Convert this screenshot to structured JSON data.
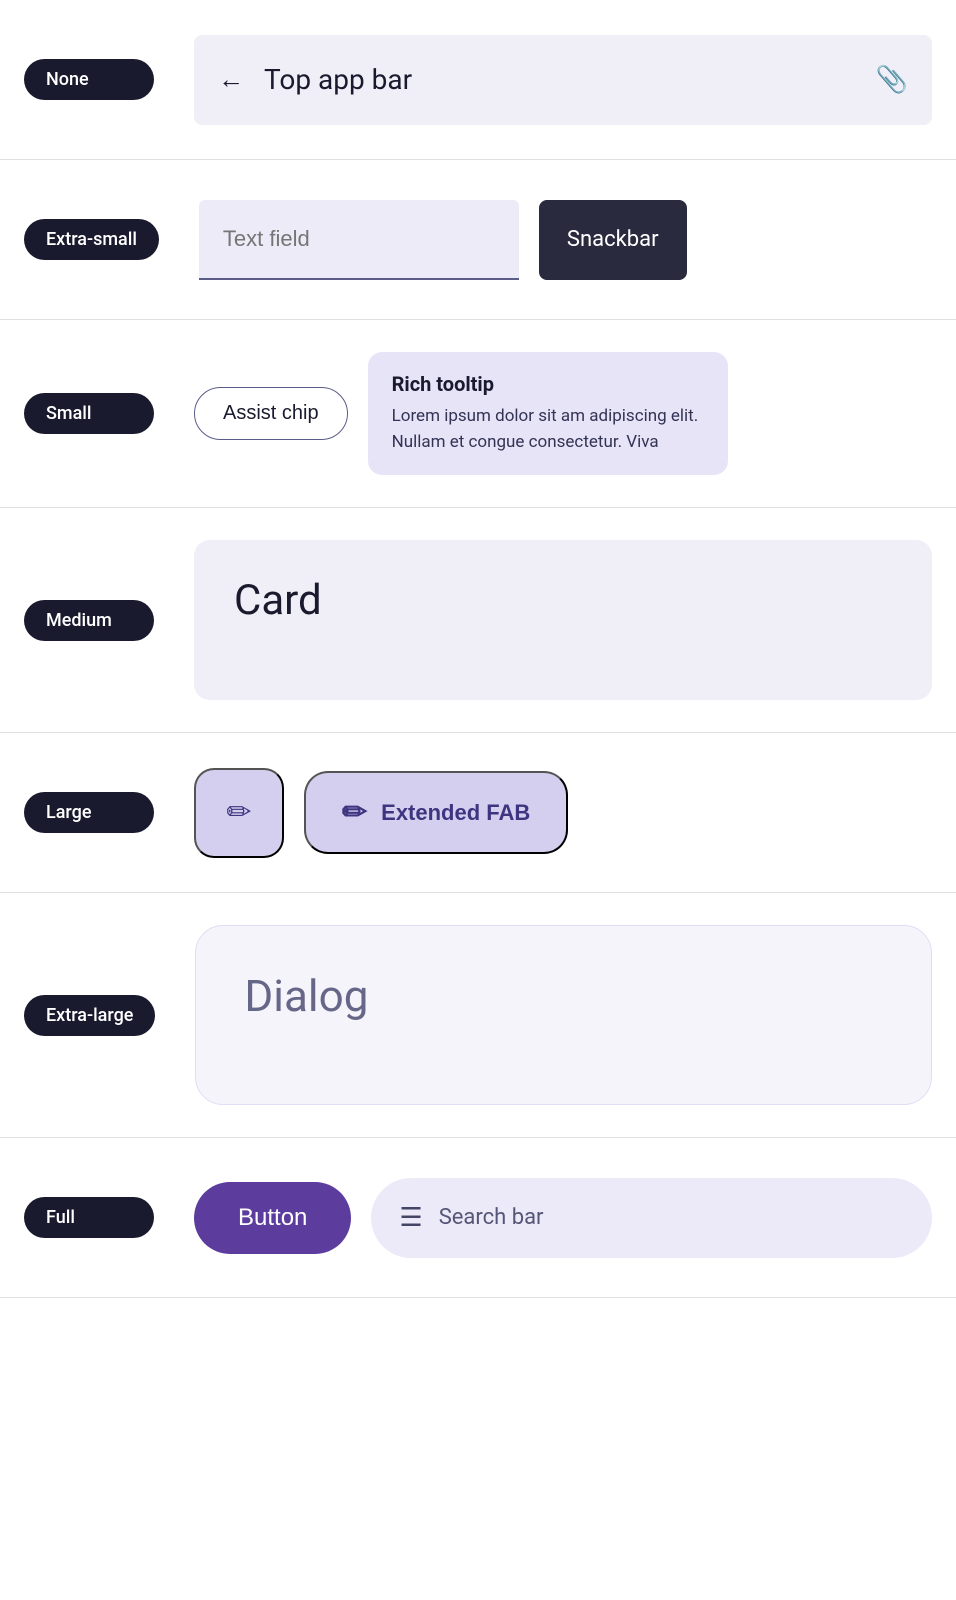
{
  "sections": {
    "none": {
      "label": "None",
      "topAppBar": {
        "backLabel": "←",
        "title": "Top app bar",
        "icon": "📎"
      }
    },
    "extraSmall": {
      "label": "Extra-small",
      "textField": {
        "placeholder": "Text field"
      },
      "snackbar": {
        "label": "Snackbar"
      }
    },
    "small": {
      "label": "Small",
      "assistChip": {
        "label": "Assist chip"
      },
      "richTooltip": {
        "title": "Rich tooltip",
        "body": "Lorem ipsum dolor sit am adipiscing elit. Nullam et congue consectetur. Viva"
      }
    },
    "medium": {
      "label": "Medium",
      "card": {
        "title": "Card"
      }
    },
    "large": {
      "label": "Large",
      "fab": {
        "iconLabel": "✏"
      },
      "extendedFab": {
        "iconLabel": "✏",
        "label": "Extended FAB"
      }
    },
    "extraLarge": {
      "label": "Extra-large",
      "dialog": {
        "title": "Dialog"
      }
    },
    "full": {
      "label": "Full",
      "button": {
        "label": "Button"
      },
      "searchBar": {
        "iconLabel": "☰",
        "placeholder": "Search bar"
      }
    }
  }
}
